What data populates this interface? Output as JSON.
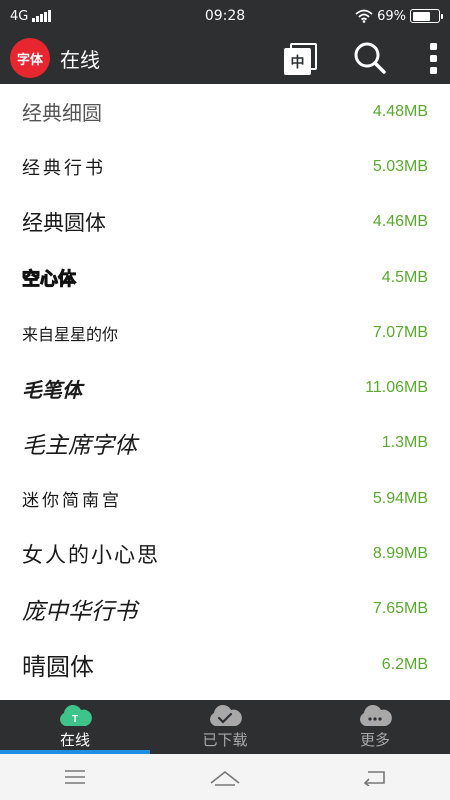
{
  "status": {
    "network": "4G",
    "time": "09:28",
    "battery": "69%",
    "battery_level": 0.69
  },
  "header": {
    "logo_text": "字体",
    "title": "在线",
    "lang_label": "中"
  },
  "fonts": [
    {
      "name": "经典细圆",
      "size": "4.48MB"
    },
    {
      "name": "经典行书",
      "size": "5.03MB"
    },
    {
      "name": "经典圆体",
      "size": "4.46MB"
    },
    {
      "name": "空心体",
      "size": "4.5MB"
    },
    {
      "name": "来自星星的你",
      "size": "7.07MB"
    },
    {
      "name": "毛笔体",
      "size": "11.06MB"
    },
    {
      "name": "毛主席字体",
      "size": "1.3MB"
    },
    {
      "name": "迷你简南宫",
      "size": "5.94MB"
    },
    {
      "name": "女人的小心思",
      "size": "8.99MB"
    },
    {
      "name": "庞中华行书",
      "size": "7.65MB"
    },
    {
      "name": "晴圆体",
      "size": "6.2MB"
    }
  ],
  "tabs": [
    {
      "label": "在线",
      "icon": "cloud-online-icon"
    },
    {
      "label": "已下载",
      "icon": "cloud-check-icon"
    },
    {
      "label": "更多",
      "icon": "cloud-more-icon"
    }
  ],
  "colors": {
    "accent_green": "#5aaa2f",
    "logo_red": "#e8262f",
    "tab_indicator": "#1f8fe0",
    "bar_dark": "#2e2f31"
  }
}
